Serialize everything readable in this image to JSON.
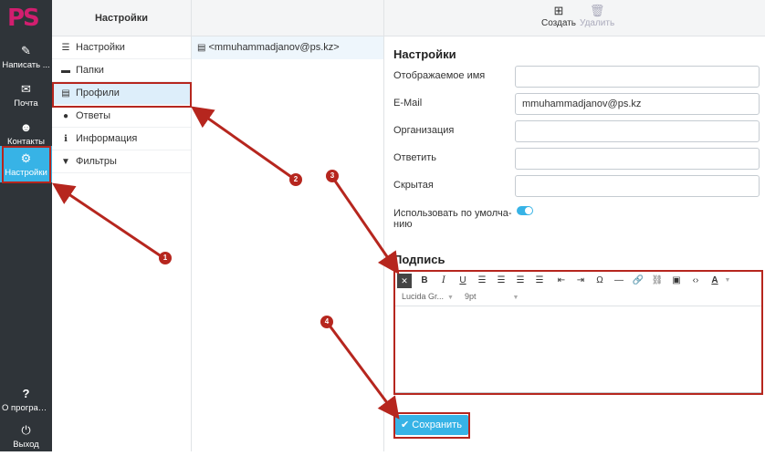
{
  "rail": {
    "logo": "PS",
    "items": [
      {
        "label": "Написать ...",
        "icon": "compose-icon"
      },
      {
        "label": "Почта",
        "icon": "mail-icon"
      },
      {
        "label": "Контакты",
        "icon": "contacts-icon"
      },
      {
        "label": "Настройки",
        "icon": "gear-icon"
      },
      {
        "label": "О програм...",
        "icon": "question-icon"
      },
      {
        "label": "Выход",
        "icon": "power-icon"
      }
    ]
  },
  "sections": {
    "title": "Настройки",
    "items": [
      {
        "label": "Настройки",
        "icon": "sliders-icon"
      },
      {
        "label": "Папки",
        "icon": "folder-icon"
      },
      {
        "label": "Профили",
        "icon": "id-card-icon"
      },
      {
        "label": "Ответы",
        "icon": "comment-icon"
      },
      {
        "label": "Информация",
        "icon": "info-icon"
      },
      {
        "label": "Фильтры",
        "icon": "filter-icon"
      }
    ]
  },
  "identities": {
    "items": [
      {
        "label": "<mmuhammadjanov@ps.kz>",
        "icon": "id-card-icon"
      }
    ]
  },
  "toolbar": {
    "create_label": "Создать",
    "delete_label": "Удалить"
  },
  "form": {
    "heading": "Настройки",
    "display_name_label": "Отображаемое имя",
    "display_name_value": "",
    "email_label": "E-Mail",
    "email_value": "mmuhammadjanov@ps.kz",
    "organization_label": "Организация",
    "organization_value": "",
    "reply_to_label": "Ответить",
    "reply_to_value": "",
    "bcc_label": "Скрытая",
    "bcc_value": "",
    "default_label": "Использовать по умолча-",
    "default_label2": "нию",
    "default_on": true
  },
  "signature": {
    "heading": "Подпись",
    "font_family": "Lucida Gr...",
    "font_size": "9pt",
    "save_label": "Сохранить"
  },
  "annotations": {
    "color": "#b6261e",
    "badges": [
      "1",
      "2",
      "3",
      "4"
    ]
  },
  "colors": {
    "accent": "#37b3e6",
    "brand": "#d21e6f",
    "rail_bg": "#2f3439"
  }
}
